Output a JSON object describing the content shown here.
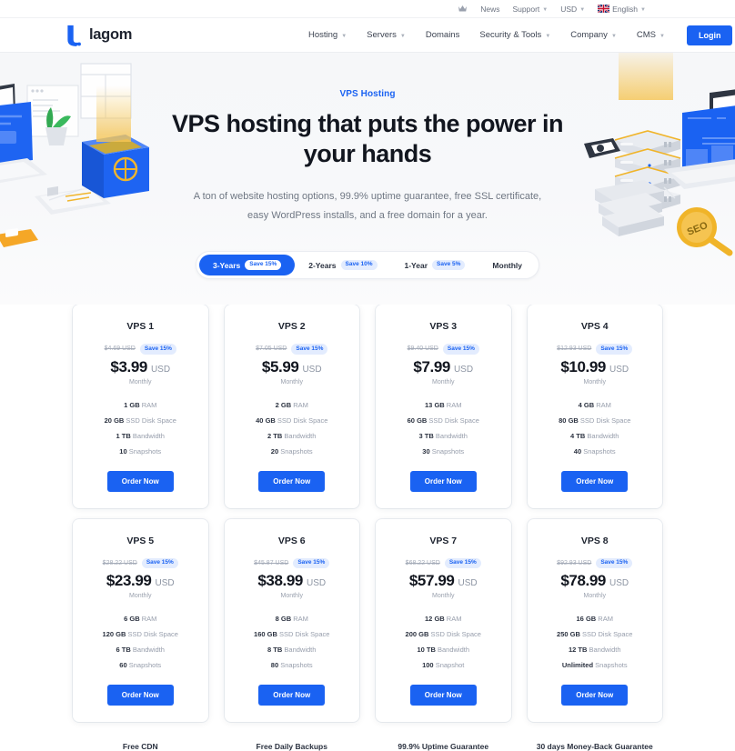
{
  "topbar": {
    "items": [
      {
        "label": "",
        "icon": "crown-icon",
        "caret": false
      },
      {
        "label": "News",
        "icon": "",
        "caret": false
      },
      {
        "label": "Support",
        "icon": "",
        "caret": true
      },
      {
        "label": "USD",
        "icon": "",
        "caret": true
      },
      {
        "label": "English",
        "icon": "uk-flag-icon",
        "caret": true
      }
    ]
  },
  "brand": {
    "name": "lagom",
    "accent": "#1a62f2"
  },
  "nav": {
    "items": [
      {
        "label": "Hosting",
        "caret": true
      },
      {
        "label": "Servers",
        "caret": true
      },
      {
        "label": "Domains",
        "caret": false
      },
      {
        "label": "Security & Tools",
        "caret": true
      },
      {
        "label": "Company",
        "caret": true
      },
      {
        "label": "CMS",
        "caret": true
      }
    ],
    "login_label": "Login"
  },
  "hero": {
    "eyebrow": "VPS Hosting",
    "title": "VPS hosting that puts the power in your hands",
    "subtitle": "A ton of website hosting options, 99.9% uptime guarantee, free SSL certificate, easy WordPress installs, and a free domain for a year."
  },
  "billing": {
    "options": [
      {
        "label": "3-Years",
        "badge": "Save 15%",
        "active": true
      },
      {
        "label": "2-Years",
        "badge": "Save 10%",
        "active": false
      },
      {
        "label": "1-Year",
        "badge": "Save 5%",
        "active": false
      },
      {
        "label": "Monthly",
        "badge": "",
        "active": false
      }
    ]
  },
  "pricing": {
    "cycle_label": "Monthly",
    "currency": "USD",
    "order_label": "Order Now",
    "plans": [
      {
        "name": "VPS 1",
        "old_price": "$4.69 USD",
        "badge": "Save 15%",
        "price": "$3.99",
        "currency": "USD",
        "cycle": "Monthly",
        "specs": [
          {
            "value": "1 GB",
            "label": "RAM"
          },
          {
            "value": "20 GB",
            "label": "SSD Disk Space"
          },
          {
            "value": "1 TB",
            "label": "Bandwidth"
          },
          {
            "value": "10",
            "label": "Snapshots"
          }
        ]
      },
      {
        "name": "VPS 2",
        "old_price": "$7.05 USD",
        "badge": "Save 15%",
        "price": "$5.99",
        "currency": "USD",
        "cycle": "Monthly",
        "specs": [
          {
            "value": "2 GB",
            "label": "RAM"
          },
          {
            "value": "40 GB",
            "label": "SSD Disk Space"
          },
          {
            "value": "2 TB",
            "label": "Bandwidth"
          },
          {
            "value": "20",
            "label": "Snapshots"
          }
        ]
      },
      {
        "name": "VPS 3",
        "old_price": "$9.40 USD",
        "badge": "Save 15%",
        "price": "$7.99",
        "currency": "USD",
        "cycle": "Monthly",
        "specs": [
          {
            "value": "13 GB",
            "label": "RAM"
          },
          {
            "value": "60 GB",
            "label": "SSD Disk Space"
          },
          {
            "value": "3 TB",
            "label": "Bandwidth"
          },
          {
            "value": "30",
            "label": "Snapshots"
          }
        ]
      },
      {
        "name": "VPS 4",
        "old_price": "$12.93 USD",
        "badge": "Save 15%",
        "price": "$10.99",
        "currency": "USD",
        "cycle": "Monthly",
        "specs": [
          {
            "value": "4 GB",
            "label": "RAM"
          },
          {
            "value": "80 GB",
            "label": "SSD Disk Space"
          },
          {
            "value": "4 TB",
            "label": "Bandwidth"
          },
          {
            "value": "40",
            "label": "Snapshots"
          }
        ]
      },
      {
        "name": "VPS 5",
        "old_price": "$28.22 USD",
        "badge": "Save 15%",
        "price": "$23.99",
        "currency": "USD",
        "cycle": "Monthly",
        "specs": [
          {
            "value": "6 GB",
            "label": "RAM"
          },
          {
            "value": "120 GB",
            "label": "SSD Disk Space"
          },
          {
            "value": "6 TB",
            "label": "Bandwidth"
          },
          {
            "value": "60",
            "label": "Snapshots"
          }
        ]
      },
      {
        "name": "VPS 6",
        "old_price": "$45.87 USD",
        "badge": "Save 15%",
        "price": "$38.99",
        "currency": "USD",
        "cycle": "Monthly",
        "specs": [
          {
            "value": "8 GB",
            "label": "RAM"
          },
          {
            "value": "160 GB",
            "label": "SSD Disk Space"
          },
          {
            "value": "8 TB",
            "label": "Bandwidth"
          },
          {
            "value": "80",
            "label": "Snapshots"
          }
        ]
      },
      {
        "name": "VPS 7",
        "old_price": "$68.22 USD",
        "badge": "Save 15%",
        "price": "$57.99",
        "currency": "USD",
        "cycle": "Monthly",
        "specs": [
          {
            "value": "12 GB",
            "label": "RAM"
          },
          {
            "value": "200 GB",
            "label": "SSD Disk Space"
          },
          {
            "value": "10 TB",
            "label": "Bandwidth"
          },
          {
            "value": "100",
            "label": "Snapshot"
          }
        ]
      },
      {
        "name": "VPS 8",
        "old_price": "$92.93 USD",
        "badge": "Save 15%",
        "price": "$78.99",
        "currency": "USD",
        "cycle": "Monthly",
        "specs": [
          {
            "value": "16 GB",
            "label": "RAM"
          },
          {
            "value": "250 GB",
            "label": "SSD Disk Space"
          },
          {
            "value": "12 TB",
            "label": "Bandwidth"
          },
          {
            "value": "Unlimited",
            "label": "Snapshots"
          }
        ]
      }
    ]
  },
  "features": [
    {
      "title": "Free CDN"
    },
    {
      "title": "Free Daily Backups"
    },
    {
      "title": "99.9% Uptime Guarantee"
    },
    {
      "title": "30 days Money-Back Guarantee"
    }
  ]
}
